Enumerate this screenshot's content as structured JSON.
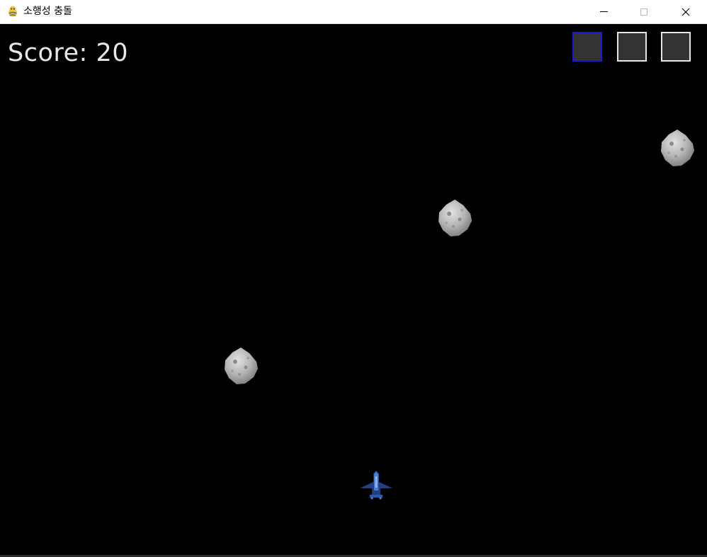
{
  "window": {
    "title": "소행성 충돌",
    "controls": [
      "minimize",
      "maximize",
      "close"
    ]
  },
  "game": {
    "score_label": "Score: 20",
    "score": 20,
    "inventory_slots": [
      {
        "index": 1,
        "selected": true
      },
      {
        "index": 2,
        "selected": false
      },
      {
        "index": 3,
        "selected": false
      }
    ],
    "asteroids": 3,
    "player": "spaceship"
  },
  "colors": {
    "background": "#000000",
    "score_text": "#e8e8e8",
    "slot_fill": "#333333",
    "slot_border": "#e6e6e6",
    "slot_selected_border": "#1a1ad6",
    "ship": "#2a4fa0"
  }
}
